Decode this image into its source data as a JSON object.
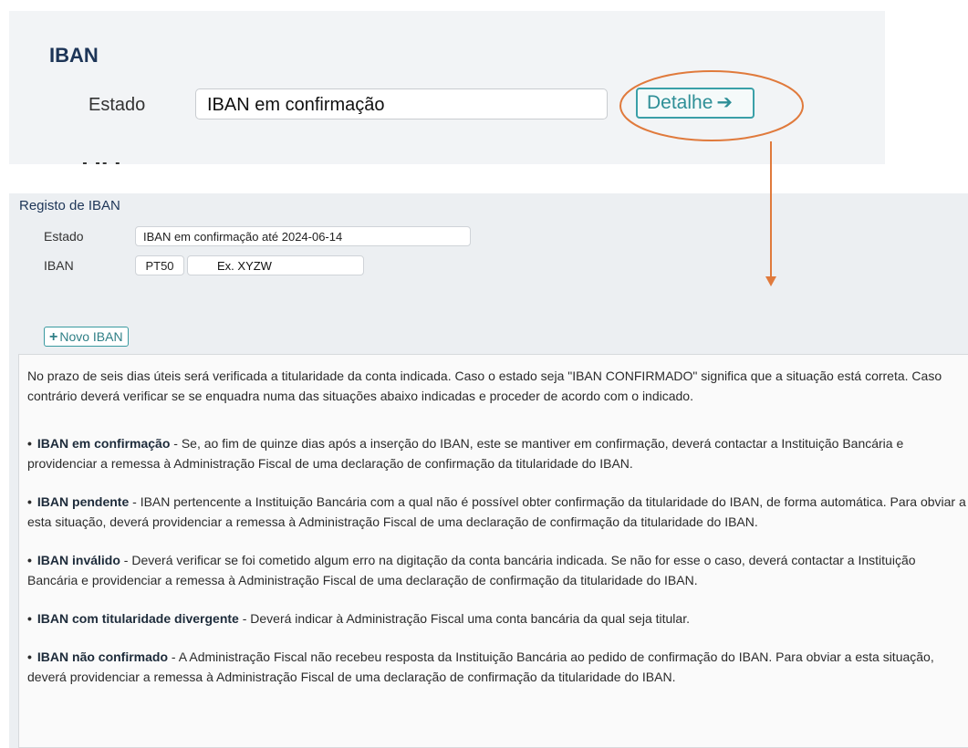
{
  "top": {
    "title": "IBAN",
    "estado_label": "Estado",
    "estado_value": "IBAN em confirmação",
    "detail_button": "Detalhe",
    "detail_arrow": "➔"
  },
  "annotation": {
    "color": "#e07a3c"
  },
  "registo": {
    "title": "Registo de IBAN",
    "estado_label": "Estado",
    "estado_value": "IBAN em confirmação até 2024-06-14",
    "iban_label": "IBAN",
    "iban_prefix": "PT50",
    "iban_value": "Ex. XYZW",
    "novo_button": "Novo IBAN",
    "novo_icon": "+"
  },
  "info": {
    "intro": "No prazo de seis dias úteis será verificada a titularidade da conta indicada. Caso o estado seja \"IBAN CONFIRMADO\" significa que a situação está correta. Caso contrário deverá verificar se se enquadra numa das situações abaixo indicadas e proceder de acordo com o indicado.",
    "items": [
      {
        "term": "IBAN em confirmação",
        "text": " - Se, ao fim de quinze dias após a inserção do IBAN, este se mantiver em confirmação, deverá contactar a Instituição Bancária e providenciar a remessa à Administração Fiscal de uma declaração de confirmação da titularidade do IBAN."
      },
      {
        "term": "IBAN pendente",
        "text": " - IBAN pertencente a Instituição Bancária com a qual não é possível obter confirmação da titularidade do IBAN, de forma automática. Para obviar a esta situação, deverá providenciar a remessa à Administração Fiscal de uma declaração de confirmação da titularidade do IBAN."
      },
      {
        "term": "IBAN inválido",
        "text": " - Deverá verificar se foi cometido algum erro na digitação da conta bancária indicada. Se não for esse o caso, deverá contactar a Instituição Bancária e providenciar a remessa à Administração Fiscal de uma declaração de confirmação da titularidade do IBAN."
      },
      {
        "term": "IBAN com titularidade divergente",
        "text": " - Deverá indicar à Administração Fiscal uma conta bancária da qual seja titular."
      },
      {
        "term": "IBAN não confirmado",
        "text": " - A Administração Fiscal não recebeu resposta da Instituição Bancária ao pedido de confirmação do IBAN. Para obviar a esta situação, deverá providenciar a remessa à Administração Fiscal de uma declaração de confirmação da titularidade do IBAN."
      }
    ]
  }
}
